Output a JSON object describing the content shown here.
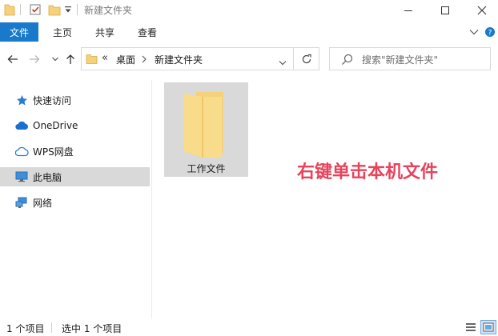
{
  "window": {
    "title": "新建文件夹",
    "quick_access_icons": [
      "folder-icon",
      "properties-check-icon",
      "new-folder-icon",
      "customize-dropdown-icon"
    ],
    "controls": [
      "minimize-icon",
      "maximize-icon",
      "close-icon"
    ]
  },
  "ribbon": {
    "file_tab": "文件",
    "tabs": [
      "主页",
      "共享",
      "查看"
    ],
    "right_icons": [
      "ribbon-expand-chevron-icon",
      "help-icon"
    ]
  },
  "navigation": {
    "buttons": [
      "back-arrow-icon",
      "forward-arrow-icon",
      "recent-dropdown-icon",
      "up-arrow-icon"
    ],
    "breadcrumb": {
      "overflow": "«",
      "items": [
        "桌面",
        "新建文件夹"
      ]
    },
    "search_placeholder": "搜索\"新建文件夹\""
  },
  "sidebar": {
    "items": [
      {
        "label": "快速访问",
        "icon": "star-icon",
        "selected": false
      },
      {
        "label": "OneDrive",
        "icon": "cloud-icon",
        "selected": false
      },
      {
        "label": "WPS网盘",
        "icon": "wps-cloud-icon",
        "selected": false
      },
      {
        "label": "此电脑",
        "icon": "monitor-icon",
        "selected": true
      },
      {
        "label": "网络",
        "icon": "network-icon",
        "selected": false
      }
    ]
  },
  "content": {
    "items": [
      {
        "name": "工作文件",
        "type": "folder",
        "selected": true
      }
    ],
    "annotation": "右键单击本机文件"
  },
  "statusbar": {
    "count": "1 个项目",
    "selected": "选中 1 个项目",
    "view_icons": [
      "details-view-icon",
      "large-icons-view-icon"
    ]
  },
  "colors": {
    "accent": "#1979ca",
    "selection": "#d9d9d9",
    "annotation": "#e8435b",
    "folder": "#f5d27a"
  }
}
